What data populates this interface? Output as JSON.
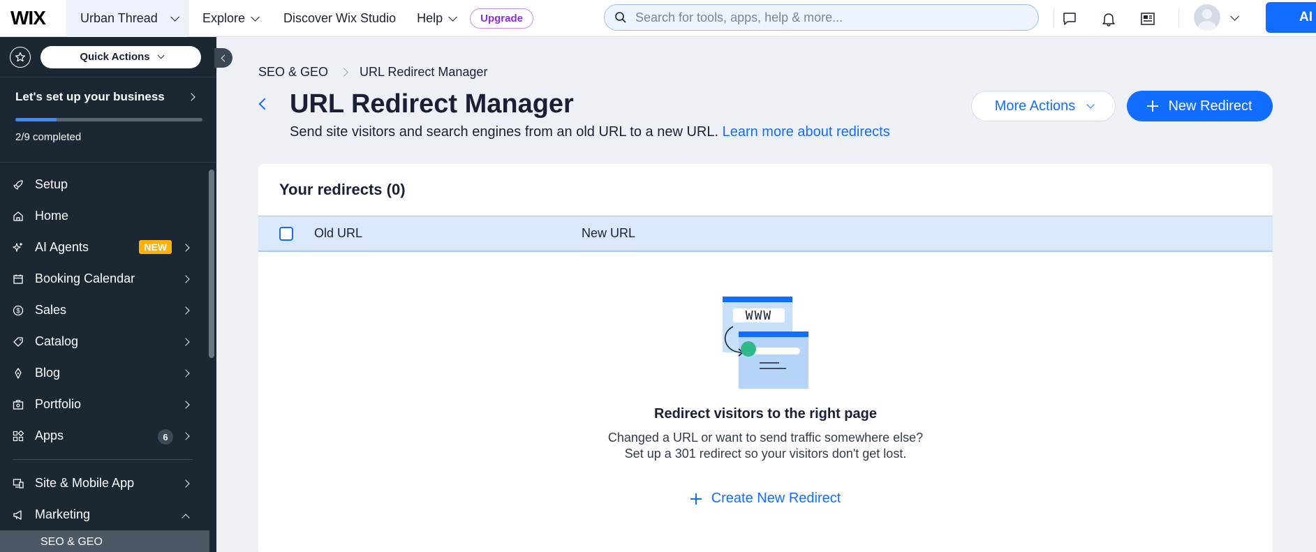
{
  "topbar": {
    "logo": "WIX",
    "site_name": "Urban Thread",
    "nav": [
      {
        "label": "Explore"
      },
      {
        "label": "Discover Wix Studio"
      },
      {
        "label": "Help"
      }
    ],
    "upgrade_label": "Upgrade",
    "search_placeholder": "Search for tools, apps, help & more...",
    "ai_label": "AI",
    "icons": [
      "chat-icon",
      "bell-icon",
      "news-icon",
      "avatar",
      "chevron-down-icon"
    ]
  },
  "sidebar": {
    "quick_actions": "Quick Actions",
    "setup_title": "Let's set up your business",
    "setup_progress_text": "2/9 completed",
    "setup_progress_fraction": 0.22,
    "items": [
      {
        "label": "Setup",
        "icon": "rocket-icon"
      },
      {
        "label": "Home",
        "icon": "home-icon"
      },
      {
        "label": "AI Agents",
        "icon": "sparkle-icon",
        "badge": "NEW"
      },
      {
        "label": "Booking Calendar",
        "icon": "calendar-icon"
      },
      {
        "label": "Sales",
        "icon": "dollar-icon"
      },
      {
        "label": "Catalog",
        "icon": "tag-icon"
      },
      {
        "label": "Blog",
        "icon": "pen-icon"
      },
      {
        "label": "Portfolio",
        "icon": "portfolio-icon"
      },
      {
        "label": "Apps",
        "icon": "apps-icon",
        "count": "6"
      },
      {
        "label": "Site & Mobile App",
        "icon": "devices-icon"
      },
      {
        "label": "Marketing",
        "icon": "megaphone-icon"
      }
    ],
    "sub_item": "SEO & GEO"
  },
  "main": {
    "breadcrumb": [
      "SEO & GEO",
      "URL Redirect Manager"
    ],
    "title": "URL Redirect Manager",
    "subtitle": "Send site visitors and search engines from an old URL to a new URL.",
    "learn_more": "Learn more about redirects",
    "more_actions": "More Actions",
    "new_redirect": "New Redirect",
    "card_title": "Your redirects (0)",
    "columns": [
      "Old URL",
      "New URL"
    ],
    "illustration_text": "WWW",
    "empty_title": "Redirect visitors to the right page",
    "empty_line1": "Changed a URL or want to send traffic somewhere else?",
    "empty_line2": "Set up a 301 redirect so your visitors don't get lost.",
    "create_link": "Create New Redirect"
  },
  "colors": {
    "accent": "#116dff",
    "sidebar_bg": "#1b2733",
    "upgrade": "#8a2be2",
    "badge_new": "#fdb10c",
    "header_row": "#d9e8fd"
  }
}
